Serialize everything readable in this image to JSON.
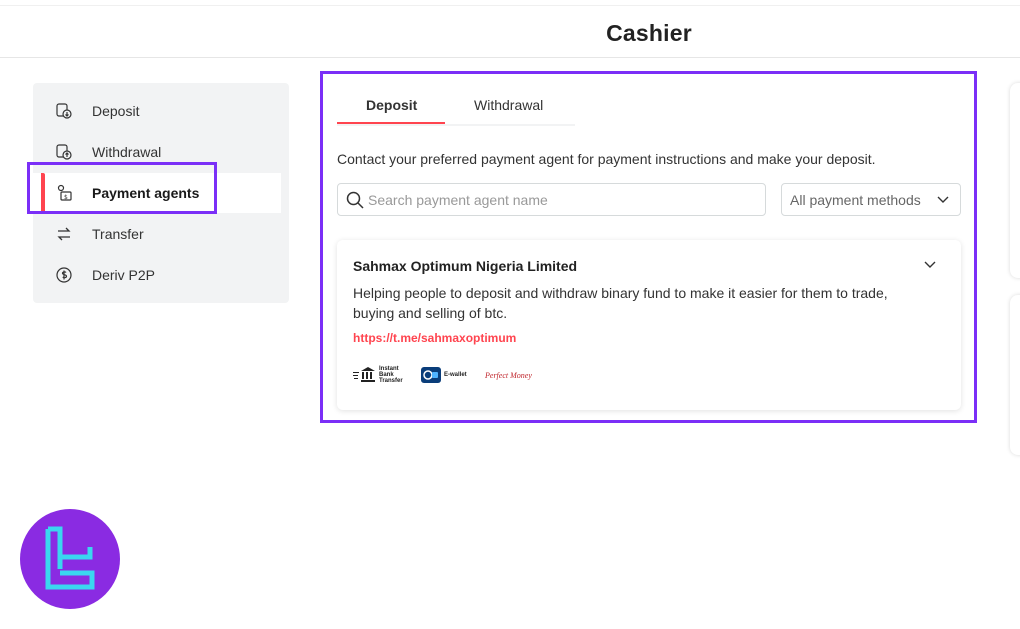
{
  "header": {
    "title": "Cashier"
  },
  "sidebar": {
    "items": [
      {
        "label": "Deposit",
        "icon": "deposit-icon"
      },
      {
        "label": "Withdrawal",
        "icon": "withdrawal-icon"
      },
      {
        "label": "Payment agents",
        "icon": "payment-agent-icon",
        "active": true
      },
      {
        "label": "Transfer",
        "icon": "transfer-icon"
      },
      {
        "label": "Deriv P2P",
        "icon": "p2p-icon"
      }
    ]
  },
  "tabs": [
    {
      "label": "Deposit",
      "active": true
    },
    {
      "label": "Withdrawal"
    }
  ],
  "intro": "Contact your preferred payment agent for payment instructions and make your deposit.",
  "search": {
    "placeholder": "Search payment agent name",
    "value": ""
  },
  "filter": {
    "selected": "All payment methods"
  },
  "agent": {
    "name": "Sahmax Optimum Nigeria Limited",
    "description": "Helping people to deposit and withdraw binary fund to make it easier for them to trade, buying and selling of btc.",
    "link": "https://t.me/sahmaxoptimum",
    "methods": [
      {
        "label": "Instant Bank Transfer",
        "lines": [
          "Instant",
          "Bank",
          "Transfer"
        ],
        "icon": "bank-icon"
      },
      {
        "label": "E-wallet",
        "icon": "ewallet-icon"
      },
      {
        "label": "Perfect Money",
        "icon": "perfect-money-icon"
      }
    ]
  },
  "colors": {
    "accent": "#ff444f",
    "highlight": "#7b2ff7",
    "logo_bg": "#8a2be2",
    "logo_fg": "#3ad6f0"
  }
}
